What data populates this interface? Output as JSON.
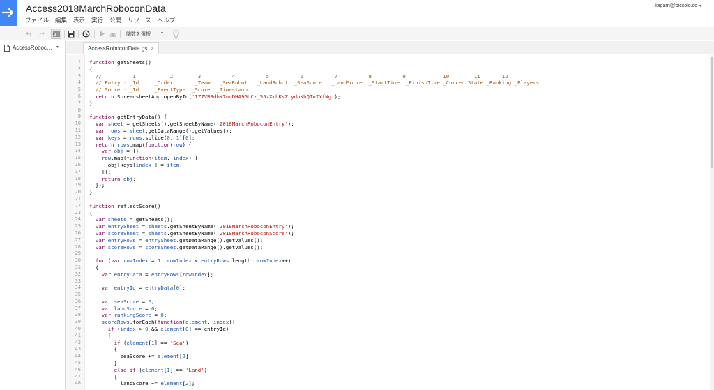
{
  "header": {
    "title": "Access2018MarchRoboconData",
    "user_email": "kagami@piccolo.co"
  },
  "menu": {
    "items": [
      "ファイル",
      "編集",
      "表示",
      "実行",
      "公開",
      "リソース",
      "ヘルプ"
    ]
  },
  "toolbar": {
    "function_select": "関数を選択",
    "icons": [
      "undo-icon",
      "redo-icon",
      "indent-icon",
      "save-icon",
      "trigger-icon",
      "run-icon",
      "debug-icon",
      "lightbulb-icon"
    ]
  },
  "sidebar": {
    "file_label": "AccessRoboc…"
  },
  "tab": {
    "label": "AccessRoboconData.gs",
    "close": "×"
  },
  "editor": {
    "lines": [
      [
        [
          "kw",
          "function"
        ],
        [
          "t",
          " getSheets()"
        ]
      ],
      [
        [
          "br",
          "{"
        ]
      ],
      [
        [
          "cm",
          "  //          1           2        3          4          5          6          7          8          9            10        11       12"
        ]
      ],
      [
        [
          "cm",
          "  // Entry : _Id     _Order       _Team   _SeaRobot   _LandRobot  _SeaScore   _LandSocre  _StartTime  _FinishTime _CurrentState _Ranking _Players"
        ]
      ],
      [
        [
          "cm",
          "  // Socre : _Id     _EventType  _Score  _Timestamp"
        ]
      ],
      [
        [
          "kw",
          "  return"
        ],
        [
          "t",
          " SpreadsheetApp.openById("
        ],
        [
          "str",
          "'1Z7VB3dhK7nqDHA9GUCz_55zXmhKsZtydpKhQTuIYfNg'"
        ],
        [
          "t",
          ");"
        ]
      ],
      [
        [
          "br",
          "}"
        ]
      ],
      [
        [
          "t",
          ""
        ]
      ],
      [
        [
          "kw",
          "function"
        ],
        [
          "t",
          " getEntryData() {"
        ]
      ],
      [
        [
          "kw",
          "  var"
        ],
        [
          "vr",
          " sheet"
        ],
        [
          "t",
          " = getSheets().getSheetByName("
        ],
        [
          "str",
          "'2018MarchRoboconEntry'"
        ],
        [
          "t",
          ");"
        ]
      ],
      [
        [
          "kw",
          "  var"
        ],
        [
          "vr",
          " rows"
        ],
        [
          "t",
          " = "
        ],
        [
          "vr",
          "sheet"
        ],
        [
          "t",
          ".getDataRange().getValues();"
        ]
      ],
      [
        [
          "kw",
          "  var"
        ],
        [
          "vr",
          " keys"
        ],
        [
          "t",
          " = "
        ],
        [
          "vr",
          "rows"
        ],
        [
          "t",
          ".splice("
        ],
        [
          "nm",
          "0"
        ],
        [
          "t",
          ", "
        ],
        [
          "nm",
          "1"
        ],
        [
          "t",
          ")["
        ],
        [
          "nm",
          "0"
        ],
        [
          "t",
          "];"
        ]
      ],
      [
        [
          "kw",
          "  return"
        ],
        [
          "vr",
          " rows"
        ],
        [
          "t",
          ".map("
        ],
        [
          "kw",
          "function"
        ],
        [
          "t",
          "("
        ],
        [
          "vr",
          "row"
        ],
        [
          "t",
          ") {"
        ]
      ],
      [
        [
          "kw",
          "    var"
        ],
        [
          "vr",
          " obj"
        ],
        [
          "t",
          " = {}"
        ]
      ],
      [
        [
          "vr",
          "    row"
        ],
        [
          "t",
          ".map("
        ],
        [
          "kw",
          "function"
        ],
        [
          "t",
          "("
        ],
        [
          "vr",
          "item"
        ],
        [
          "t",
          ", "
        ],
        [
          "vr",
          "index"
        ],
        [
          "t",
          ") {"
        ]
      ],
      [
        [
          "t",
          "      obj[keys["
        ],
        [
          "vr",
          "index"
        ],
        [
          "t",
          "]] = "
        ],
        [
          "vr",
          "item"
        ],
        [
          "t",
          ";"
        ]
      ],
      [
        [
          "t",
          "    });"
        ]
      ],
      [
        [
          "kw",
          "    return"
        ],
        [
          "vr",
          " obj"
        ],
        [
          "t",
          ";"
        ]
      ],
      [
        [
          "t",
          "  });"
        ]
      ],
      [
        [
          "t",
          "}"
        ]
      ],
      [
        [
          "t",
          ""
        ]
      ],
      [
        [
          "kw",
          "function"
        ],
        [
          "t",
          " reflectScore()"
        ]
      ],
      [
        [
          "t",
          "{"
        ]
      ],
      [
        [
          "kw",
          "  var"
        ],
        [
          "vr",
          " sheets"
        ],
        [
          "t",
          " = getSheets();"
        ]
      ],
      [
        [
          "kw",
          "  var"
        ],
        [
          "vr",
          " entrySheet"
        ],
        [
          "t",
          " = "
        ],
        [
          "vr",
          "sheets"
        ],
        [
          "t",
          ".getSheetByName("
        ],
        [
          "str",
          "'2018MarchRoboconEntry'"
        ],
        [
          "t",
          ");"
        ]
      ],
      [
        [
          "kw",
          "  var"
        ],
        [
          "vr",
          " scoreSheet"
        ],
        [
          "t",
          " = "
        ],
        [
          "vr",
          "sheets"
        ],
        [
          "t",
          ".getSheetByName("
        ],
        [
          "str",
          "'2018MarchRoboconScore'"
        ],
        [
          "t",
          ");"
        ]
      ],
      [
        [
          "kw",
          "  var"
        ],
        [
          "vr",
          " entryRows"
        ],
        [
          "t",
          " = "
        ],
        [
          "vr",
          "entrySheet"
        ],
        [
          "t",
          ".getDataRange().getValues();"
        ]
      ],
      [
        [
          "kw",
          "  var"
        ],
        [
          "vr",
          " scoreRows"
        ],
        [
          "t",
          " = "
        ],
        [
          "vr",
          "scoreSheet"
        ],
        [
          "t",
          ".getDataRange().getValues();"
        ]
      ],
      [
        [
          "t",
          ""
        ]
      ],
      [
        [
          "kw",
          "  for"
        ],
        [
          "t",
          " ("
        ],
        [
          "kw",
          "var"
        ],
        [
          "vr",
          " rowIndex"
        ],
        [
          "t",
          " = "
        ],
        [
          "nm",
          "1"
        ],
        [
          "t",
          "; "
        ],
        [
          "vr",
          "rowIndex"
        ],
        [
          "t",
          " < "
        ],
        [
          "vr",
          "entryRows"
        ],
        [
          "t",
          ".length; "
        ],
        [
          "vr",
          "rowIndex"
        ],
        [
          "t",
          "++)"
        ]
      ],
      [
        [
          "t",
          "  {"
        ]
      ],
      [
        [
          "kw",
          "    var"
        ],
        [
          "vr",
          " entryData"
        ],
        [
          "t",
          " = "
        ],
        [
          "vr",
          "entryRows"
        ],
        [
          "t",
          "["
        ],
        [
          "vr",
          "rowIndex"
        ],
        [
          "t",
          "];"
        ]
      ],
      [
        [
          "t",
          ""
        ]
      ],
      [
        [
          "kw",
          "    var"
        ],
        [
          "vr",
          " entryId"
        ],
        [
          "t",
          " = "
        ],
        [
          "vr",
          "entryData"
        ],
        [
          "t",
          "["
        ],
        [
          "nm",
          "0"
        ],
        [
          "t",
          "];"
        ]
      ],
      [
        [
          "t",
          ""
        ]
      ],
      [
        [
          "kw",
          "    var"
        ],
        [
          "vr",
          " seaScore"
        ],
        [
          "t",
          " = "
        ],
        [
          "nm",
          "0"
        ],
        [
          "t",
          ";"
        ]
      ],
      [
        [
          "kw",
          "    var"
        ],
        [
          "vr",
          " landScore"
        ],
        [
          "t",
          " = "
        ],
        [
          "nm",
          "0"
        ],
        [
          "t",
          ";"
        ]
      ],
      [
        [
          "kw",
          "    var"
        ],
        [
          "vr",
          " rankingScore"
        ],
        [
          "t",
          " = "
        ],
        [
          "nm",
          "0"
        ],
        [
          "t",
          ";"
        ]
      ],
      [
        [
          "vr",
          "    scoreRows"
        ],
        [
          "t",
          ".forEach("
        ],
        [
          "kw",
          "function"
        ],
        [
          "t",
          "("
        ],
        [
          "vr",
          "element"
        ],
        [
          "t",
          ", "
        ],
        [
          "vr",
          "index"
        ],
        [
          "t",
          ")"
        ],
        [
          "br",
          "{"
        ]
      ],
      [
        [
          "kw",
          "      if"
        ],
        [
          "t",
          " ("
        ],
        [
          "vr",
          "index"
        ],
        [
          "t",
          " > "
        ],
        [
          "nm",
          "0"
        ],
        [
          "t",
          " && "
        ],
        [
          "vr",
          "element"
        ],
        [
          "t",
          "["
        ],
        [
          "nm",
          "0"
        ],
        [
          "t",
          "] == entryId)"
        ]
      ],
      [
        [
          "br",
          "      {"
        ]
      ],
      [
        [
          "kw",
          "        if"
        ],
        [
          "t",
          " ("
        ],
        [
          "vr",
          "element"
        ],
        [
          "t",
          "["
        ],
        [
          "nm",
          "1"
        ],
        [
          "t",
          "] == "
        ],
        [
          "str",
          "'Sea'"
        ],
        [
          "t",
          ")"
        ]
      ],
      [
        [
          "t",
          "        {"
        ]
      ],
      [
        [
          "t",
          "          seaScore += "
        ],
        [
          "vr",
          "element"
        ],
        [
          "t",
          "["
        ],
        [
          "nm",
          "2"
        ],
        [
          "t",
          "];"
        ]
      ],
      [
        [
          "t",
          "        }"
        ]
      ],
      [
        [
          "kw",
          "        else if"
        ],
        [
          "t",
          " ("
        ],
        [
          "vr",
          "element"
        ],
        [
          "t",
          "["
        ],
        [
          "nm",
          "1"
        ],
        [
          "t",
          "] == "
        ],
        [
          "str",
          "'Land'"
        ],
        [
          "t",
          ")"
        ]
      ],
      [
        [
          "t",
          "        {"
        ]
      ],
      [
        [
          "t",
          "          landScore += "
        ],
        [
          "vr",
          "element"
        ],
        [
          "t",
          "["
        ],
        [
          "nm",
          "2"
        ],
        [
          "t",
          "];"
        ]
      ]
    ]
  }
}
